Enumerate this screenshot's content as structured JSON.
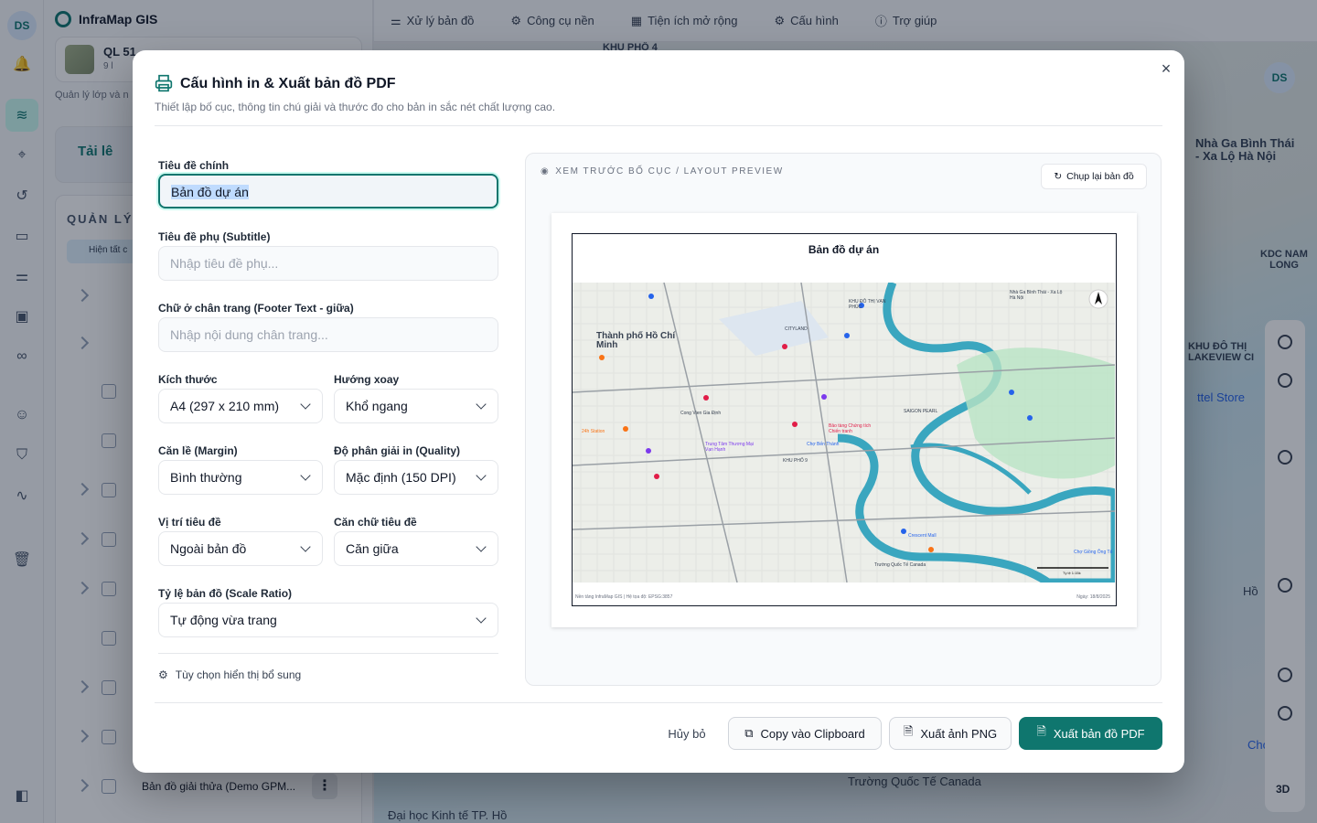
{
  "app": {
    "rail_avatar": "DS",
    "name": "InfraMap GIS",
    "project": {
      "name": "QL 51",
      "sub": "9 l"
    },
    "layer_manager_text": "Quản lý lớp và n",
    "upload_label": "Tải lê",
    "layers_heading": "QUẢN LÝ L",
    "layers_chip": "Hiện tất c",
    "last_layer": "Bản đồ giải thửa (Demo GPM...",
    "more_icon": "⋮"
  },
  "topnav": [
    {
      "label": "Xử lý bản đồ",
      "icon": "sliders-icon"
    },
    {
      "label": "Công cụ nền",
      "icon": "gear-icon"
    },
    {
      "label": "Tiện ích mở rộng",
      "icon": "calendar-icon"
    },
    {
      "label": "Cấu hình",
      "icon": "gear-icon"
    },
    {
      "label": "Trợ giúp",
      "icon": "help-icon"
    }
  ],
  "map": {
    "user_badge": "DS",
    "labels": [
      "KHU PHỐ 4",
      "Nhà Ga Bình Thái - Xa Lộ Hà Nội",
      "KDC NAM LONG",
      "KHU ĐÔ THỊ LAKEVIEW CI",
      "ttel Store",
      "Trường Quốc Tế Canada",
      "Đại học Kinh tế TP. Hồ",
      "Hồ",
      "Chợ"
    ]
  },
  "modal": {
    "title": "Cấu hình in & Xuất bản đồ PDF",
    "subtitle": "Thiết lập bố cục, thông tin chú giải và thước đo cho bản in sắc nét chất lượng cao.",
    "close": "×",
    "fields": {
      "main_title": {
        "label": "Tiêu đề chính",
        "value": "Bản đồ dự án"
      },
      "subtitle": {
        "label": "Tiêu đề phụ (Subtitle)",
        "placeholder": "Nhập tiêu đề phụ..."
      },
      "footer": {
        "label": "Chữ ở chân trang (Footer Text - giữa)",
        "placeholder": "Nhập nội dung chân trang..."
      },
      "size": {
        "label": "Kích thước",
        "value": "A4 (297 x 210 mm)"
      },
      "orientation": {
        "label": "Hướng xoay",
        "value": "Khổ ngang"
      },
      "margin": {
        "label": "Căn lề (Margin)",
        "value": "Bình thường"
      },
      "quality": {
        "label": "Độ phân giải in (Quality)",
        "value": "Mặc định (150 DPI)"
      },
      "title_position": {
        "label": "Vị trí tiêu đề",
        "value": "Ngoài bản đồ"
      },
      "title_align": {
        "label": "Căn chữ tiêu đề",
        "value": "Căn giữa"
      },
      "scale": {
        "label": "Tỷ lệ bản đồ (Scale Ratio)",
        "value": "Tự động vừa trang"
      }
    },
    "extra_options": "Tùy chọn hiển thị bổ sung",
    "preview": {
      "heading": "XEM TRƯỚC BỐ CỤC / LAYOUT PREVIEW",
      "recapture": "Chụp lại bản đồ",
      "paper_title": "Bản đồ dự án",
      "footer_left": "Nền tảng InfraMap GIS | Hệ tọa độ: EPSG:3857",
      "footer_right": "Ngày: 18/8/2025",
      "map_labels": [
        "Thành phố Hồ Chí Minh",
        "KHU ĐÔ THỊ VẠN PHÚC",
        "Nhà Ga Bình Thái - Xa Lộ Hà Nội",
        "SAIGON PEARL",
        "Bảo tàng Chứng tích Chiến tranh",
        "Chợ Bến Thành",
        "Crescent Mall",
        "Trường Quốc Tế Canada",
        "Chợ Giồng Ông Tố",
        "24h Station",
        "CITYLAND",
        "KHU PHỐ 9",
        "Cong Vien Gia Định",
        "Trung Tâm Thương Mại Vạn Hạnh"
      ],
      "scale_label": "Tỷ lệ 1:15k"
    },
    "buttons": {
      "cancel": "Hủy bỏ",
      "copy": "Copy vào Clipboard",
      "png": "Xuất ảnh PNG",
      "pdf": "Xuất bản đồ PDF"
    }
  },
  "colors": {
    "accent": "#0f766e",
    "accent_light": "#ccfbf1"
  }
}
